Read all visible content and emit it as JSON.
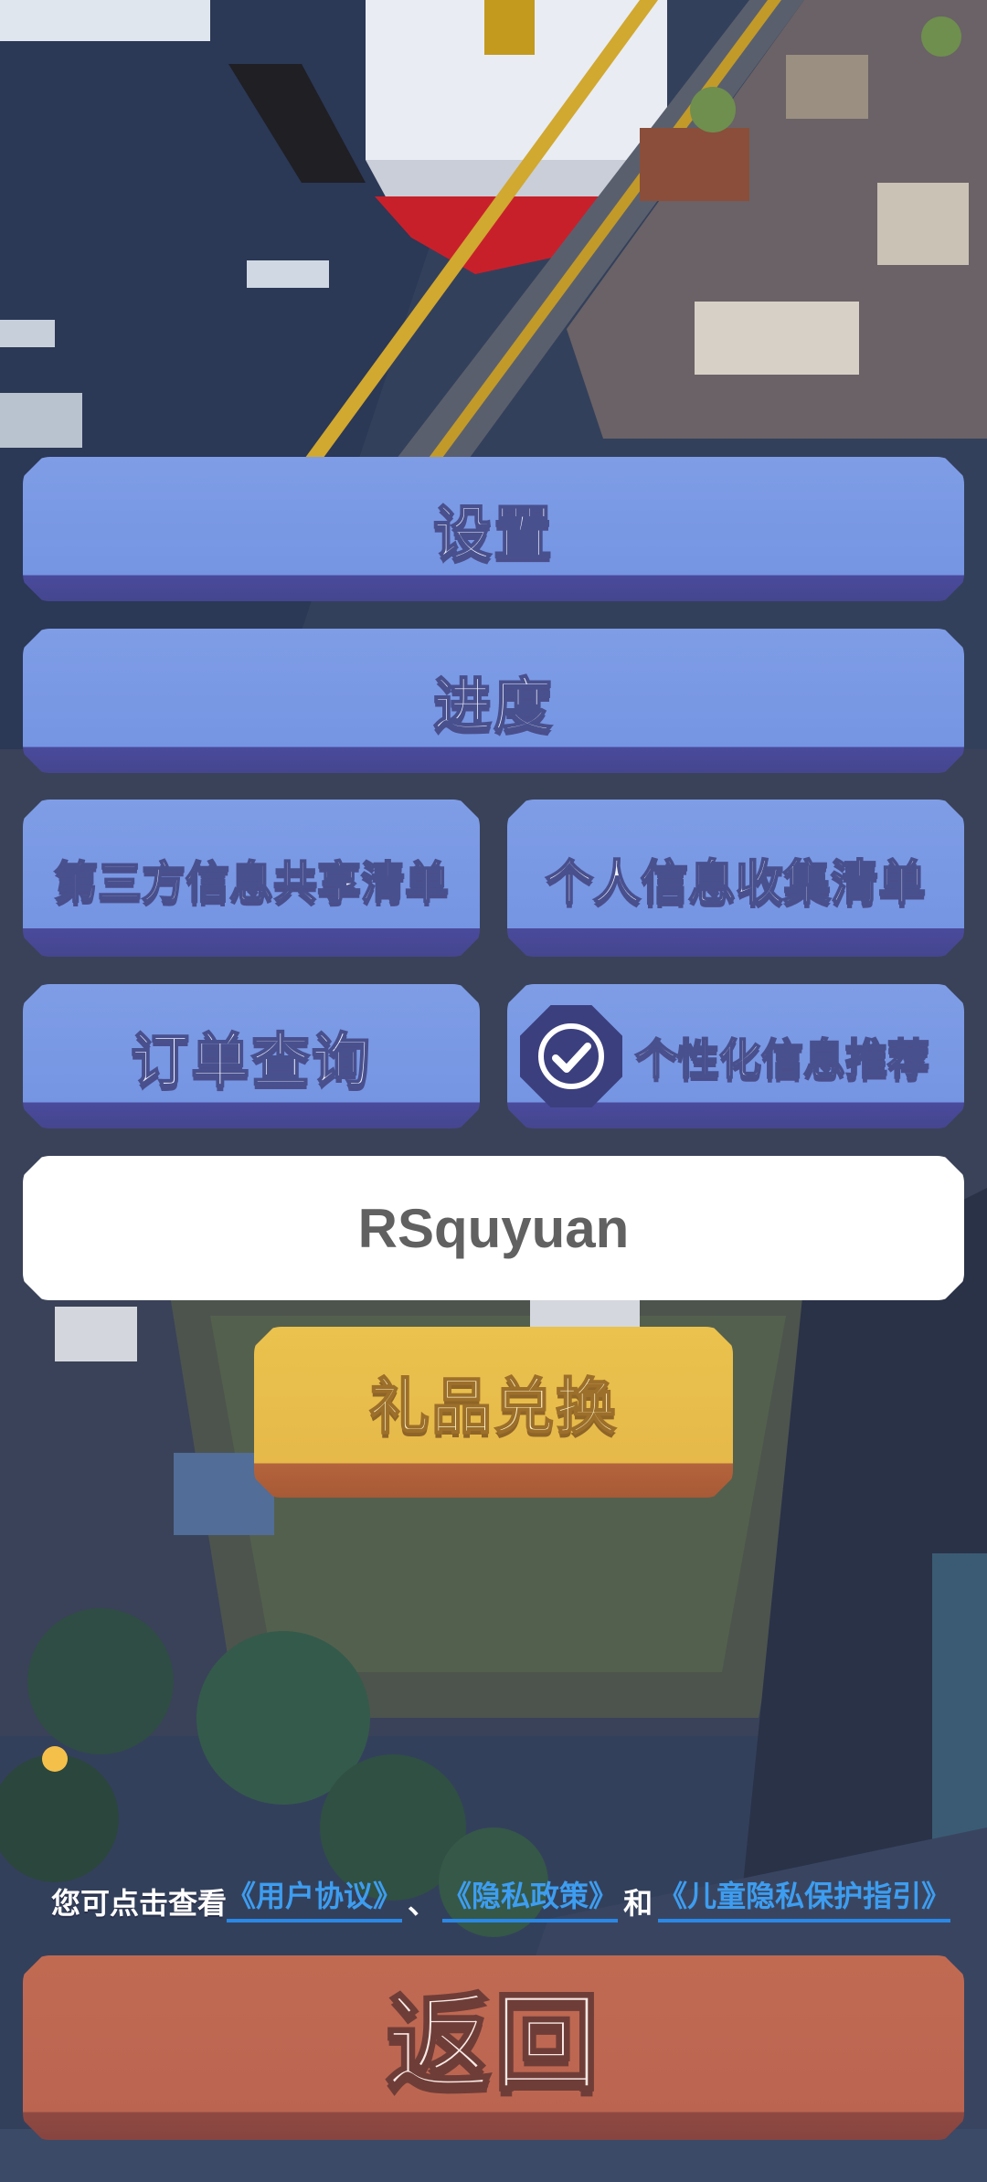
{
  "menu": {
    "settings_label": "设置",
    "progress_label": "进度",
    "third_party_label": "第三方信息共享清单",
    "personal_info_label": "个人信息收集清单",
    "order_query_label": "订单查询",
    "personalized_label": "个性化信息推荐",
    "personalized_checked": true
  },
  "code_input": {
    "value": "RSquyuan"
  },
  "gift_label": "礼品兑换",
  "agreement": {
    "prefix": "您可点击查看",
    "user_agreement": "《用户协议》",
    "separator": "、",
    "privacy_policy": "《隐私政策》",
    "and": "和",
    "child_privacy": "《儿童隐私保护指引》"
  },
  "back_label": "返回",
  "colors": {
    "button_blue": "#7595e3",
    "button_yellow": "#e6b94a",
    "button_red": "#bb6551",
    "link_blue": "#3d9df0"
  }
}
